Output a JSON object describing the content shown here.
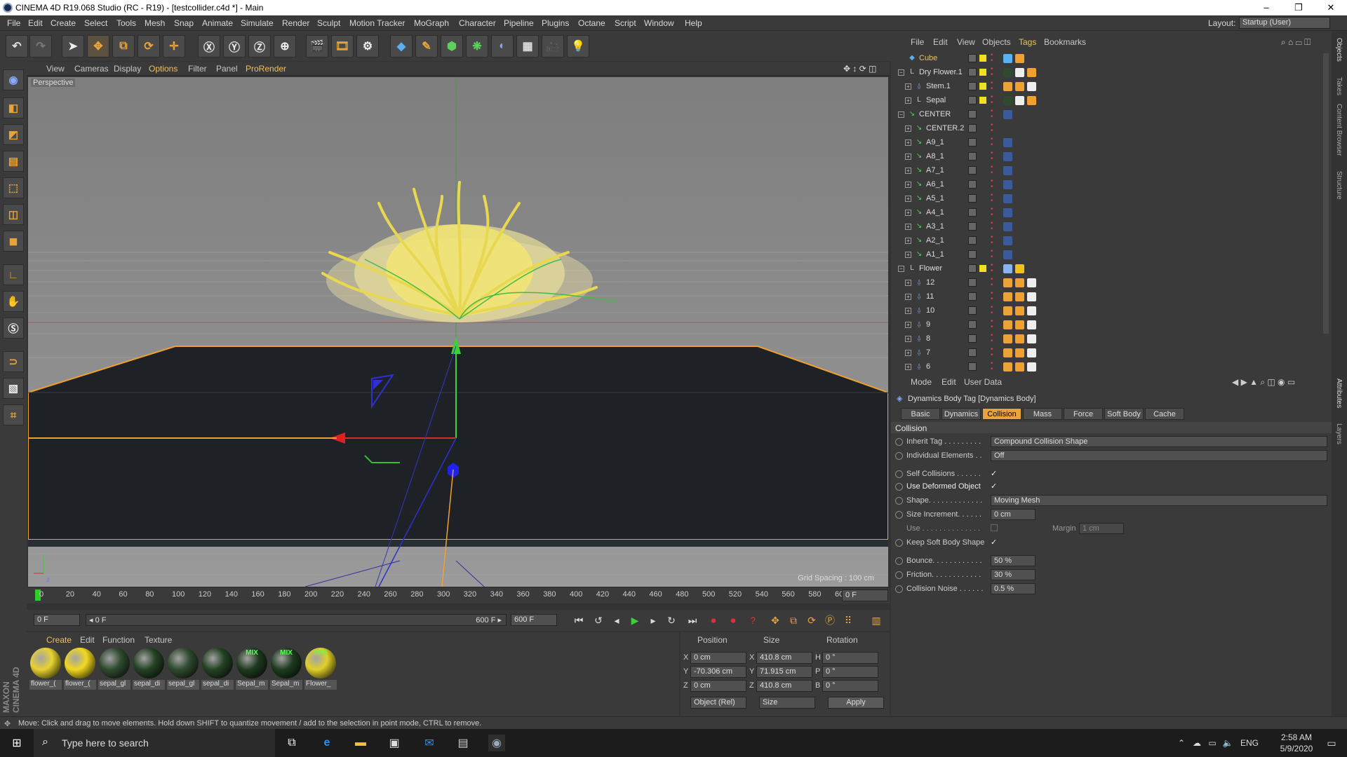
{
  "window": {
    "title": "CINEMA 4D R19.068 Studio (RC - R19) - [testcollider.c4d *] - Main",
    "controls": [
      "–",
      "❐",
      "✕"
    ]
  },
  "menubar": {
    "items": [
      "File",
      "Edit",
      "Create",
      "Select",
      "Tools",
      "Mesh",
      "Snap",
      "Animate",
      "Simulate",
      "Render",
      "Sculpt",
      "Motion Tracker",
      "MoGraph",
      "Character",
      "Pipeline",
      "Plugins",
      "Octane",
      "Script",
      "Window",
      "Help"
    ],
    "layout_label": "Layout:",
    "layout_value": "Startup (User)"
  },
  "viewport": {
    "menu": [
      "View",
      "Cameras",
      "Display",
      "Options",
      "Filter",
      "Panel",
      "ProRender"
    ],
    "label": "Perspective",
    "grid_spacing": "Grid Spacing : 100 cm"
  },
  "timeline": {
    "ticks": [
      "0",
      "20",
      "40",
      "60",
      "80",
      "100",
      "120",
      "140",
      "160",
      "180",
      "200",
      "220",
      "240",
      "260",
      "280",
      "300",
      "320",
      "340",
      "360",
      "380",
      "400",
      "420",
      "440",
      "460",
      "480",
      "500",
      "520",
      "540",
      "560",
      "580",
      "60("
    ],
    "current_frame": "0 F",
    "start": "0 F",
    "range_start": "◂ 0 F",
    "range_end": "600 F ▸",
    "end": "600 F"
  },
  "materials": {
    "menu": [
      "Create",
      "Edit",
      "Function",
      "Texture"
    ],
    "items": [
      {
        "name": "flower_(",
        "color": "#e8d230"
      },
      {
        "name": "flower_(",
        "color": "#f2d820"
      },
      {
        "name": "sepal_gl",
        "color": "#2f4a2f"
      },
      {
        "name": "sepal_di",
        "color": "#244224"
      },
      {
        "name": "sepal_gl",
        "color": "#2f4a2f"
      },
      {
        "name": "sepal_di",
        "color": "#244224"
      },
      {
        "name": "Sepal_m",
        "color": "#1f3a1f",
        "mix": "MIX"
      },
      {
        "name": "Sepal_m",
        "color": "#1f3a1f",
        "mix": "MIX"
      },
      {
        "name": "Flower_",
        "color": "#e0cf2a",
        "mix": "MIX"
      }
    ]
  },
  "coordinates": {
    "headers": [
      "Position",
      "Size",
      "Rotation"
    ],
    "rows": [
      {
        "axis": "X",
        "pos": "0 cm",
        "size_axis": "X",
        "size": "410.8 cm",
        "rot_axis": "H",
        "rot": "0 °"
      },
      {
        "axis": "Y",
        "pos": "-70.306 cm",
        "size_axis": "Y",
        "size": "71.915 cm",
        "rot_axis": "P",
        "rot": "0 °"
      },
      {
        "axis": "Z",
        "pos": "0 cm",
        "size_axis": "Z",
        "size": "410.8 cm",
        "rot_axis": "B",
        "rot": "0 °"
      }
    ],
    "mode": "Object (Rel)",
    "size_mode": "Size",
    "apply": "Apply"
  },
  "status": "Move: Click and drag to move elements. Hold down SHIFT to quantize movement / add to the selection in point mode, CTRL to remove.",
  "objects": {
    "menu": [
      "File",
      "Edit",
      "View",
      "Objects",
      "Tags",
      "Bookmarks"
    ],
    "rows": [
      {
        "name": "Cube",
        "indent": 0,
        "icon": "cube",
        "color": "#7ab"
      },
      {
        "name": "Dry Flower.1",
        "indent": 0,
        "icon": "null",
        "color": "#ddd"
      },
      {
        "name": "Stem.1",
        "indent": 1,
        "icon": "bone",
        "color": "#ddd"
      },
      {
        "name": "Sepal",
        "indent": 1,
        "icon": "null",
        "color": "#ddd"
      },
      {
        "name": "CENTER",
        "indent": 0,
        "icon": "spline",
        "color": "#ddd"
      },
      {
        "name": "CENTER.2",
        "indent": 1,
        "icon": "spline",
        "color": "#ddd"
      },
      {
        "name": "A9_1",
        "indent": 1,
        "icon": "spline",
        "color": "#ddd"
      },
      {
        "name": "A8_1",
        "indent": 1,
        "icon": "spline",
        "color": "#ddd"
      },
      {
        "name": "A7_1",
        "indent": 1,
        "icon": "spline",
        "color": "#ddd"
      },
      {
        "name": "A6_1",
        "indent": 1,
        "icon": "spline",
        "color": "#ddd"
      },
      {
        "name": "A5_1",
        "indent": 1,
        "icon": "spline",
        "color": "#ddd"
      },
      {
        "name": "A4_1",
        "indent": 1,
        "icon": "spline",
        "color": "#ddd"
      },
      {
        "name": "A3_1",
        "indent": 1,
        "icon": "spline",
        "color": "#ddd"
      },
      {
        "name": "A2_1",
        "indent": 1,
        "icon": "spline",
        "color": "#ddd"
      },
      {
        "name": "A1_1",
        "indent": 1,
        "icon": "spline",
        "color": "#ddd"
      },
      {
        "name": "Flower",
        "indent": 0,
        "icon": "null",
        "color": "#ddd"
      },
      {
        "name": "12",
        "indent": 1,
        "icon": "bone",
        "color": "#ddd"
      },
      {
        "name": "11",
        "indent": 1,
        "icon": "bone",
        "color": "#ddd"
      },
      {
        "name": "10",
        "indent": 1,
        "icon": "bone",
        "color": "#ddd"
      },
      {
        "name": "9",
        "indent": 1,
        "icon": "bone",
        "color": "#ddd"
      },
      {
        "name": "8",
        "indent": 1,
        "icon": "bone",
        "color": "#ddd"
      },
      {
        "name": "7",
        "indent": 1,
        "icon": "bone",
        "color": "#ddd"
      },
      {
        "name": "6",
        "indent": 1,
        "icon": "bone",
        "color": "#ddd"
      }
    ]
  },
  "attributes": {
    "menu": [
      "Mode",
      "Edit",
      "User Data"
    ],
    "title": "Dynamics Body Tag [Dynamics Body]",
    "tabs": [
      "Basic",
      "Dynamics",
      "Collision",
      "Mass",
      "Force",
      "Soft Body",
      "Cache"
    ],
    "active_tab": "Collision",
    "section": "Collision",
    "inherit_tag_label": "Inherit Tag . . . . . . . . .",
    "inherit_tag_value": "Compound Collision Shape",
    "individual_label": "Individual Elements . .",
    "individual_value": "Off",
    "self_collisions_label": "Self Collisions . . . . . .",
    "use_deformed_label": "Use Deformed Object",
    "shape_label": "Shape. . . . . . . . . . . . .",
    "shape_value": "Moving Mesh",
    "size_increment_label": "Size Increment. . . . . .",
    "size_increment_value": "0 cm",
    "use_label": "Use . . . . . . . . . . . . . .",
    "margin_label": "Margin",
    "margin_value": "1 cm",
    "keep_soft_label": "Keep Soft Body Shape",
    "bounce_label": "Bounce. . . . . . . . . . . .",
    "bounce_value": "50 %",
    "friction_label": "Friction. . . . . . . . . . . .",
    "friction_value": "30 %",
    "noise_label": "Collision Noise . . . . . .",
    "noise_value": "0.5 %",
    "check": "✓"
  },
  "right_strip": [
    "Objects",
    "Takes",
    "Content Browser",
    "Structure",
    "Attributes",
    "Layers"
  ],
  "taskbar": {
    "search_placeholder": "Type here to search",
    "lang": "ENG",
    "time": "2:58 AM",
    "date": "5/9/2020"
  },
  "colors": {
    "accent": "#e8a33a",
    "selection_orange": "#f0a030"
  }
}
